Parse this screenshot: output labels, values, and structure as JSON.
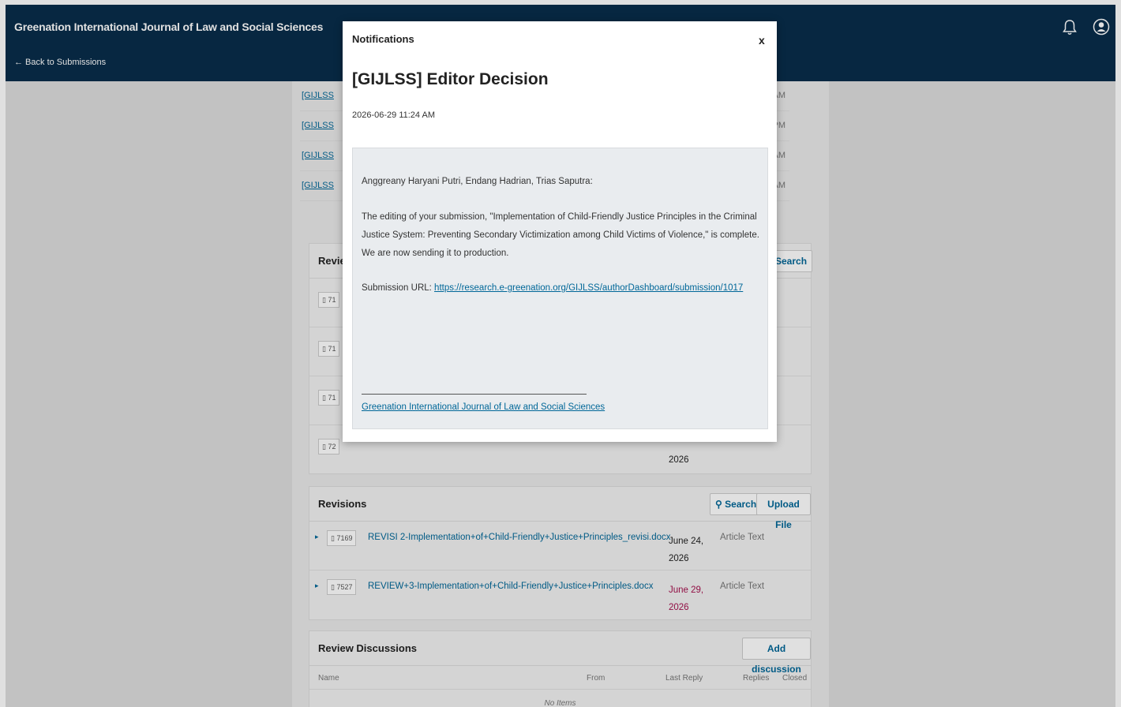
{
  "header": {
    "journal_title": "Greenation International Journal of Law and Social Sciences",
    "back_link": "← Back to Submissions"
  },
  "notifications_list": [
    {
      "label": "[GIJLSS",
      "time": ":54 AM"
    },
    {
      "label": "[GIJLSS",
      "time": ":01 PM"
    },
    {
      "label": "[GIJLSS",
      "time": ":31 AM"
    },
    {
      "label": "[GIJLSS",
      "time": ":24 AM"
    }
  ],
  "review_panel": {
    "title": "Revie",
    "search_label": "Search",
    "rows": [
      {
        "id": "71"
      },
      {
        "id": "71"
      },
      {
        "id": "71"
      },
      {
        "id": "72",
        "date_year": "2026"
      }
    ]
  },
  "revisions": {
    "title": "Revisions",
    "search_label": "Search",
    "upload_label": "Upload File",
    "rows": [
      {
        "id": "7169",
        "file": "REVISI 2-Implementation+of+Child-Friendly+Justice+Principles_revisi.docx",
        "date_line1": "June 24,",
        "date_line2": "2026",
        "type": "Article Text",
        "date_color": "#222222"
      },
      {
        "id": "7527",
        "file": "REVIEW+3-Implementation+of+Child-Friendly+Justice+Principles.docx",
        "date_line1": "June 29,",
        "date_line2": "2026",
        "type": "Article Text",
        "date_color": "#a5114e"
      }
    ]
  },
  "review_discussions": {
    "title": "Review Discussions",
    "add_label": "Add discussion",
    "columns": [
      "Name",
      "From",
      "Last Reply",
      "Replies",
      "Closed"
    ],
    "empty": "No Items"
  },
  "modal": {
    "label": "Notifications",
    "close": "x",
    "heading": "[GIJLSS] Editor Decision",
    "date": "2026-06-29 11:24 AM",
    "greeting": "Anggreany Haryani Putri, Endang Hadrian, Trias Saputra:",
    "body": "The editing of your submission, \"Implementation of Child-Friendly Justice Principles in the Criminal Justice System: Preventing Secondary Victimization among Child Victims of Violence,\" is complete. We are now sending it to production.",
    "url_label": "Submission URL:",
    "url": "https://research.e-greenation.org/GIJLSS/authorDashboard/submission/1017",
    "signature": "Greenation International Journal of Law and Social Sciences"
  },
  "colors": {
    "header_bg": "#082d4a",
    "link": "#006798",
    "message_bg": "#e9ecef"
  }
}
